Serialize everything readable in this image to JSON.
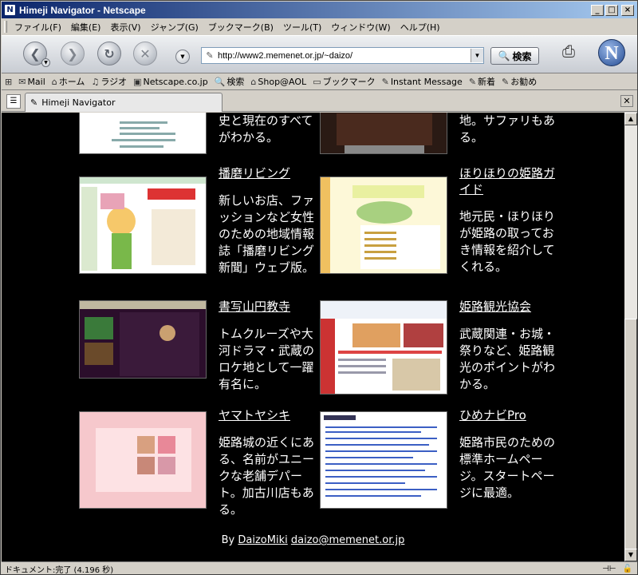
{
  "window": {
    "title": "Himeji Navigator - Netscape"
  },
  "menu": [
    "ファイル(F)",
    "編集(E)",
    "表示(V)",
    "ジャンプ(G)",
    "ブックマーク(B)",
    "ツール(T)",
    "ウィンドウ(W)",
    "ヘルプ(H)"
  ],
  "nav": {
    "url": "http://www2.memenet.or.jp/~daizo/",
    "search_label": "検索"
  },
  "personal": [
    {
      "icon": "mail-icon",
      "label": "Mail"
    },
    {
      "icon": "home-icon",
      "label": "ホーム"
    },
    {
      "icon": "radio-icon",
      "label": "ラジオ"
    },
    {
      "icon": "my-icon",
      "label": "Netscape.co.jp"
    },
    {
      "icon": "search-icon",
      "label": "検索"
    },
    {
      "icon": "shop-icon",
      "label": "Shop@AOL"
    },
    {
      "icon": "bookmark-icon",
      "label": "ブックマーク"
    },
    {
      "icon": "bookmark-link-icon",
      "label": "Instant Message"
    },
    {
      "icon": "bookmark-link-icon",
      "label": "新着"
    },
    {
      "icon": "bookmark-link-icon",
      "label": "お勧め"
    }
  ],
  "tab": {
    "label": "Himeji Navigator"
  },
  "sites": [
    {
      "title": "",
      "desc": "史と現在のすべてがわかる。",
      "cut": true
    },
    {
      "title": "",
      "desc": "地。サファリもある。",
      "cut": true
    },
    {
      "title": "播磨リビング",
      "desc": "新しいお店、ファッションなど女性のための地域情報誌「播磨リビング新聞」ウェブ版。"
    },
    {
      "title": "ほりほりの姫路ガイド",
      "desc": "地元民・ほりほりが姫路の取っておき情報を紹介してくれる。"
    },
    {
      "title": "書写山円教寺",
      "desc": "トムクルーズや大河ドラマ・武蔵のロケ地として一躍有名に。"
    },
    {
      "title": "姫路観光協会",
      "desc": "武蔵関連・お城・祭りなど、姫路観光のポイントがわかる。"
    },
    {
      "title": "ヤマトヤシキ",
      "desc": "姫路城の近くにある、名前がユニークな老舗デパート。加古川店もある。"
    },
    {
      "title": "ひめナビPro",
      "desc": "姫路市民のための標準ホームページ。スタートページに最適。"
    }
  ],
  "footer": {
    "by": "By",
    "author": "DaizoMiki",
    "email": "daizo@memenet.or.jp"
  },
  "status": {
    "text": "ドキュメント:完了 (4.196 秒)"
  }
}
